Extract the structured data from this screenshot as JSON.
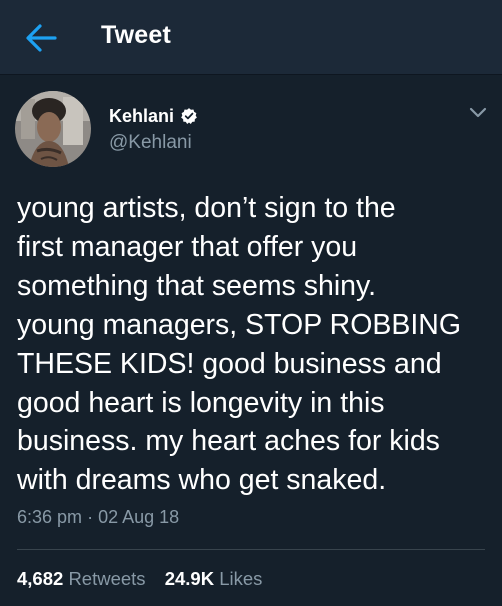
{
  "header": {
    "back_icon": "arrow-left-icon",
    "title": "Tweet"
  },
  "author": {
    "display_name": "Kehlani",
    "verified_icon": "verified-badge-icon",
    "handle": "@Kehlani"
  },
  "menu_icon": "chevron-down-icon",
  "tweet": {
    "lines": [
      "young artists, don’t sign to the",
      "first manager that offer you",
      "something that seems shiny.",
      "young managers, STOP ROBBING",
      "THESE KIDS! good business and",
      "good heart is longevity in this",
      "business. my heart aches for kids",
      "with dreams who get snaked."
    ],
    "time": "6:36 pm",
    "separator": "·",
    "date": "02 Aug 18"
  },
  "stats": {
    "retweets_count": "4,682",
    "retweets_label": "Retweets",
    "likes_count": "24.9K",
    "likes_label": "Likes"
  },
  "colors": {
    "background": "#15202b",
    "header_background": "#1c2938",
    "accent": "#1da1f2",
    "secondary_text": "#8899a6",
    "divider": "#38444d"
  }
}
